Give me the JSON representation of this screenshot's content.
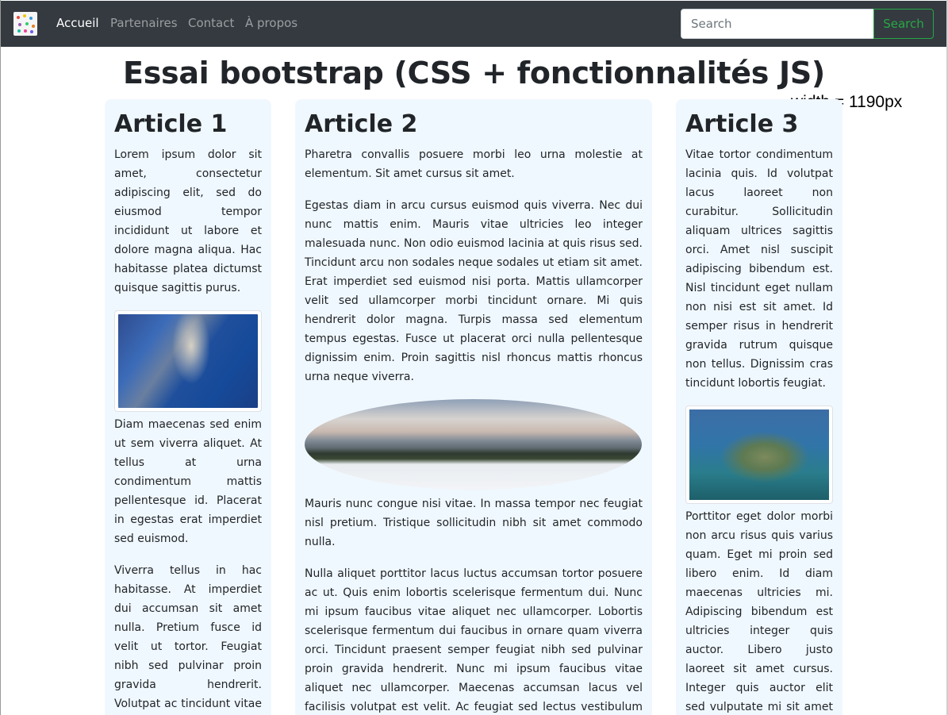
{
  "navbar": {
    "links": [
      "Accueil",
      "Partenaires",
      "Contact",
      "À propos"
    ],
    "search_placeholder": "Search",
    "search_button": "Search"
  },
  "page": {
    "title": "Essai bootstrap (CSS + fonctionnalités JS)",
    "width_note": "width = 1190px"
  },
  "articles": [
    {
      "title": "Article 1",
      "paragraphs": [
        "Lorem ipsum dolor sit amet, consectetur adipiscing elit, sed do eiusmod tempor incididunt ut labore et dolore magna aliqua. Hac habitasse platea dictumst quisque sagittis purus.",
        "Diam maecenas sed enim ut sem viverra aliquet. At tellus at urna condimentum mattis pellentesque id. Placerat in egestas erat imperdiet sed euismod.",
        "Viverra tellus in hac habitasse. At imperdiet dui accumsan sit amet nulla. Pretium fusce id velit ut tortor. Feugiat nibh sed pulvinar proin gravida hendrerit. Volutpat ac tincidunt vitae semper quis lectus nulla."
      ]
    },
    {
      "title": "Article 2",
      "paragraphs": [
        "Pharetra convallis posuere morbi leo urna molestie at elementum. Sit amet cursus sit amet.",
        "Egestas diam in arcu cursus euismod quis viverra. Nec dui nunc mattis enim. Mauris vitae ultricies leo integer malesuada nunc. Non odio euismod lacinia at quis risus sed. Tincidunt arcu non sodales neque sodales ut etiam sit amet. Erat imperdiet sed euismod nisi porta. Mattis ullamcorper velit sed ullamcorper morbi tincidunt ornare. Mi quis hendrerit dolor magna. Turpis massa sed elementum tempus egestas. Fusce ut placerat orci nulla pellentesque dignissim enim. Proin sagittis nisl rhoncus mattis rhoncus urna neque viverra.",
        "Mauris nunc congue nisi vitae. In massa tempor nec feugiat nisl pretium. Tristique sollicitudin nibh sit amet commodo nulla.",
        "Nulla aliquet porttitor lacus luctus accumsan tortor posuere ac ut. Quis enim lobortis scelerisque fermentum dui. Nunc mi ipsum faucibus vitae aliquet nec ullamcorper. Lobortis scelerisque fermentum dui faucibus in ornare quam viverra orci. Tincidunt praesent semper feugiat nibh sed pulvinar proin gravida hendrerit. Nunc mi ipsum faucibus vitae aliquet nec ullamcorper. Maecenas accumsan lacus vel facilisis volutpat est velit. Ac feugiat sed lectus vestibulum mattis ullamcorper velit sed."
      ]
    },
    {
      "title": "Article 3",
      "paragraphs": [
        "Vitae tortor condimentum lacinia quis. Id volutpat lacus laoreet non curabitur. Sollicitudin aliquam ultrices sagittis orci. Amet nisl suscipit adipiscing bibendum est. Nisl tincidunt eget nullam non nisi est sit amet. Id semper risus in hendrerit gravida rutrum quisque non tellus. Dignissim cras tincidunt lobortis feugiat.",
        "Porttitor eget dolor morbi non arcu risus quis varius quam. Eget mi proin sed libero enim. Id diam maecenas ultricies mi. Adipiscing bibendum est ultricies integer quis auctor. Libero justo laoreet sit amet cursus. Integer quis auctor elit sed vulputate mi sit amet mauris commodo."
      ]
    }
  ]
}
